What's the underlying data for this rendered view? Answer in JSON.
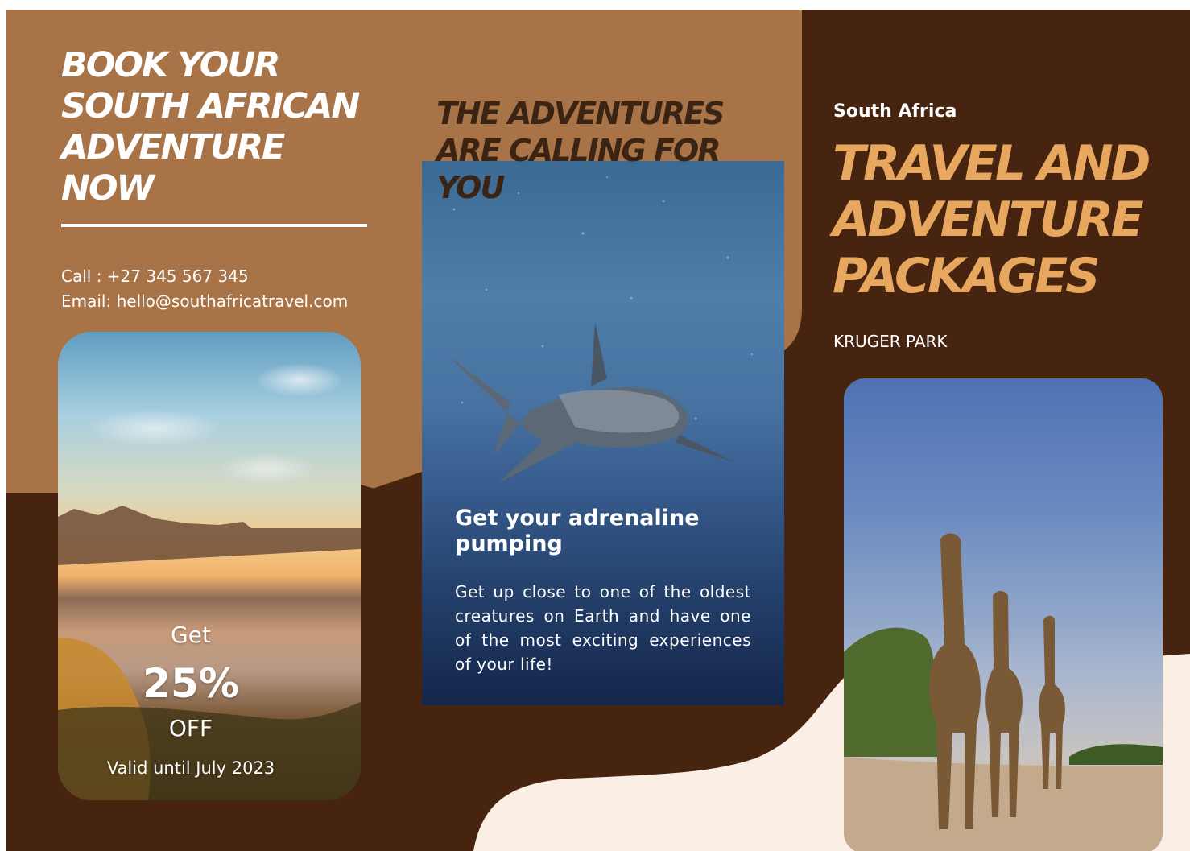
{
  "panel_left": {
    "headline": "Book your South African adventure now",
    "contact_phone": "Call : +27 345 567 345",
    "contact_email": "Email: hello@southafricatravel.com",
    "offer": {
      "prefix": "Get",
      "discount": "25%",
      "suffix": "OFF",
      "validity": "Valid until July 2023"
    }
  },
  "panel_middle": {
    "headline": "The adventures are calling for you",
    "card_title": "Get your adrenaline pumping",
    "card_text": "Get up close to one of the oldest creatures on Earth and have one of the most exciting experiences of your life!"
  },
  "panel_right": {
    "subtitle": "South Africa",
    "headline": "Travel and adventure packages",
    "location": "KRUGER PARK"
  },
  "colors": {
    "tan": "#a87447",
    "dark_brown": "#46240f",
    "cream": "#fbeee5",
    "orange_accent": "#e7a75f"
  },
  "images": {
    "beach": "coastal-sunset-photo",
    "shark": "shark-underwater-photo",
    "giraffes": "giraffes-on-road-photo"
  }
}
